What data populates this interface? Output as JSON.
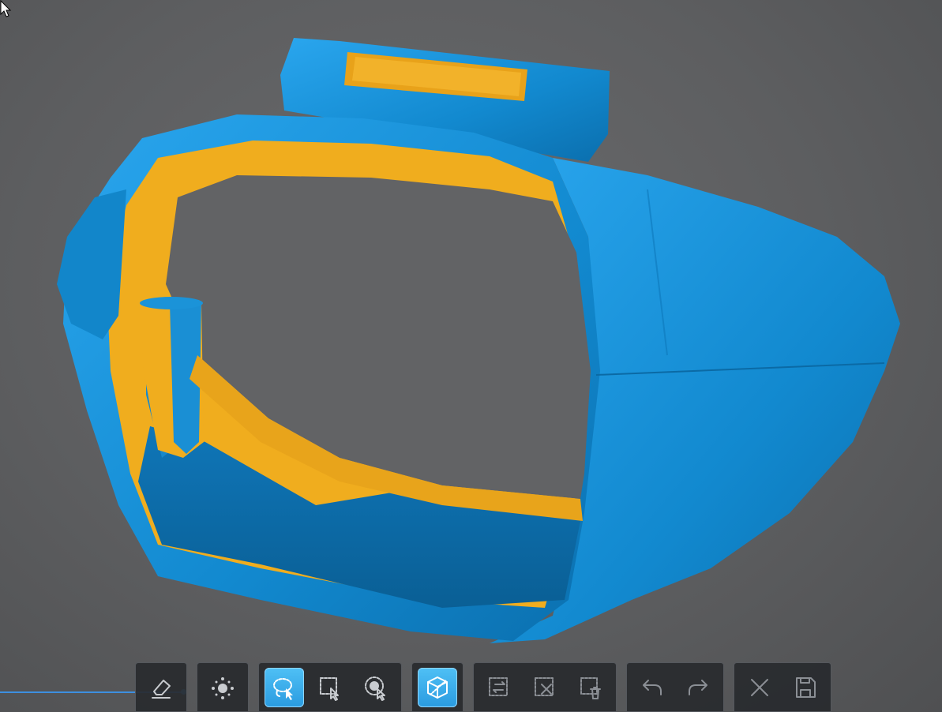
{
  "app": {
    "viewport_background": "#5f6062",
    "accent": "#2fa8ec"
  },
  "model": {
    "shell_color": "#1289cf",
    "inner_surface_color": "#f0ad1e"
  },
  "toolbar": {
    "groups": [
      {
        "name": "edit",
        "buttons": [
          {
            "icon": "eraser-icon",
            "active": false
          }
        ]
      },
      {
        "name": "light",
        "buttons": [
          {
            "icon": "lighting-icon",
            "active": false
          }
        ]
      },
      {
        "name": "selection",
        "buttons": [
          {
            "icon": "lasso-select-icon",
            "active": true
          },
          {
            "icon": "rectangle-select-icon",
            "active": false
          },
          {
            "icon": "brush-select-icon",
            "active": false
          }
        ]
      },
      {
        "name": "view",
        "buttons": [
          {
            "icon": "through-select-cube-icon",
            "active": true
          }
        ]
      },
      {
        "name": "selection-ops",
        "buttons": [
          {
            "icon": "invert-selection-icon",
            "active": false
          },
          {
            "icon": "clear-selection-icon",
            "active": false
          },
          {
            "icon": "delete-selection-icon",
            "active": false
          }
        ]
      },
      {
        "name": "history",
        "buttons": [
          {
            "icon": "undo-icon",
            "active": false
          },
          {
            "icon": "redo-icon",
            "active": false
          }
        ]
      },
      {
        "name": "file",
        "buttons": [
          {
            "icon": "close-icon",
            "active": false
          },
          {
            "icon": "save-icon",
            "active": false
          }
        ]
      }
    ]
  }
}
